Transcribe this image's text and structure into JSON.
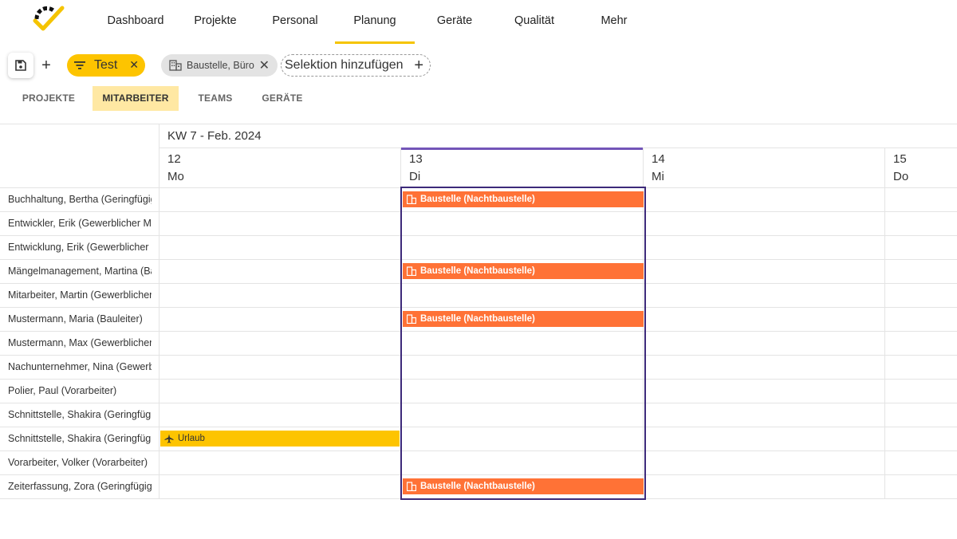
{
  "nav": {
    "items": [
      {
        "label": "Dashboard",
        "active": false
      },
      {
        "label": "Projekte",
        "active": false
      },
      {
        "label": "Personal",
        "active": false
      },
      {
        "label": "Planung",
        "active": true
      },
      {
        "label": "Geräte",
        "active": false
      },
      {
        "label": "Qualität",
        "active": false
      },
      {
        "label": "Mehr",
        "active": false
      }
    ]
  },
  "toolbar": {
    "filter_chip": "Test",
    "location_chip": "Baustelle, Büro",
    "add_selection": "Selektion hinzufügen"
  },
  "tabs": [
    {
      "label": "PROJEKTE",
      "active": false
    },
    {
      "label": "MITARBEITER",
      "active": true
    },
    {
      "label": "TEAMS",
      "active": false
    },
    {
      "label": "GERÄTE",
      "active": false
    }
  ],
  "calendar": {
    "week_label": "KW 7 - Feb. 2024",
    "days": [
      {
        "num": "12",
        "name": "Mo"
      },
      {
        "num": "13",
        "name": "Di"
      },
      {
        "num": "14",
        "name": "Mi"
      },
      {
        "num": "15",
        "name": "Do"
      }
    ],
    "rows": [
      {
        "name": "Buchhaltung, Bertha (Geringfügig Beschäftigt)"
      },
      {
        "name": "Entwickler, Erik (Gewerblicher Mitarbeiter)"
      },
      {
        "name": "Entwicklung, Erik (Gewerblicher Mitarbeiter)"
      },
      {
        "name": "Mängelmanagement, Martina (Bauleiter)"
      },
      {
        "name": "Mitarbeiter, Martin (Gewerblicher Mitarbeiter)"
      },
      {
        "name": "Mustermann, Maria (Bauleiter)"
      },
      {
        "name": "Mustermann, Max (Gewerblicher Mitarbeiter)"
      },
      {
        "name": "Nachunternehmer, Nina (Gewerblicher Mitarbeiter)"
      },
      {
        "name": "Polier, Paul (Vorarbeiter)"
      },
      {
        "name": "Schnittstelle, Shakira (Geringfügig Beschäftigt)"
      },
      {
        "name": "Schnittstelle, Shakira (Geringfügig Beschäftigt)"
      },
      {
        "name": "Vorarbeiter, Volker (Vorarbeiter)"
      },
      {
        "name": "Zeiterfassung, Zora (Geringfügig Beschäftigt)"
      }
    ],
    "events": [
      {
        "row": 0,
        "label": "Baustelle (Nachtbaustelle)",
        "kind": "baustelle"
      },
      {
        "row": 3,
        "label": "Baustelle (Nachtbaustelle)",
        "kind": "baustelle"
      },
      {
        "row": 5,
        "label": "Baustelle (Nachtbaustelle)",
        "kind": "baustelle"
      },
      {
        "row": 12,
        "label": "Baustelle (Nachtbaustelle)",
        "kind": "baustelle"
      },
      {
        "row": 10,
        "label": "Urlaub",
        "kind": "urlaub"
      }
    ]
  },
  "colors": {
    "accent": "#fdc400",
    "event_baustelle": "#ff7236",
    "today": "#7355b8",
    "selection": "#3d2a7a"
  }
}
